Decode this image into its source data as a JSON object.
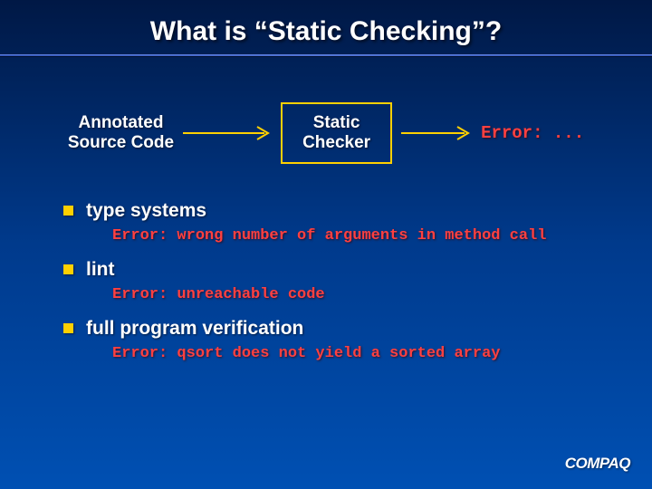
{
  "title": "What is “Static Checking”?",
  "diagram": {
    "input": "Annotated\nSource Code",
    "process": "Static\nChecker",
    "output": "Error: ..."
  },
  "bullets": [
    {
      "label": "type systems",
      "error": "Error: wrong number of arguments in method call"
    },
    {
      "label": "lint",
      "error": "Error: unreachable code"
    },
    {
      "label": "full program verification",
      "error": "Error: qsort does not yield a sorted array"
    }
  ],
  "logo": "COMPAQ"
}
